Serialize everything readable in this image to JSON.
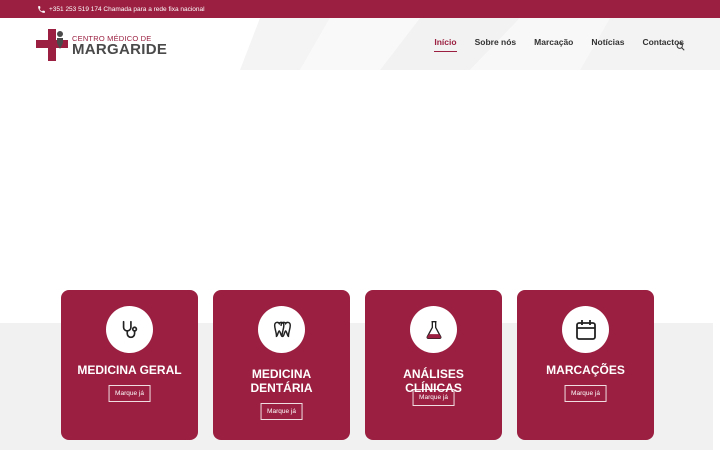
{
  "topbar": {
    "phone_text": "+351 253 519 174 Chamada para a rede fixa nacional"
  },
  "logo": {
    "line1": "CENTRO MÉDICO DE",
    "line2": "MARGARIDE"
  },
  "nav": {
    "items": [
      {
        "label": "Início",
        "active": true
      },
      {
        "label": "Sobre nós"
      },
      {
        "label": "Marcação"
      },
      {
        "label": "Notícias"
      },
      {
        "label": "Contactos"
      }
    ]
  },
  "cards": [
    {
      "title": "MEDICINA GERAL",
      "button": "Marque já",
      "icon": "stethoscope-icon"
    },
    {
      "title": "MEDICINA DENTÁRIA",
      "button": "Marque já",
      "icon": "tooth-icon"
    },
    {
      "title": "ANÁLISES CLÍNICAS",
      "button": "Marque já",
      "icon": "flask-icon"
    },
    {
      "title": "MARCAÇÕES",
      "button": "Marque já",
      "icon": "calendar-icon"
    }
  ],
  "colors": {
    "brand": "#9a1f40",
    "text": "#333333",
    "band": "#f1f1f1"
  }
}
